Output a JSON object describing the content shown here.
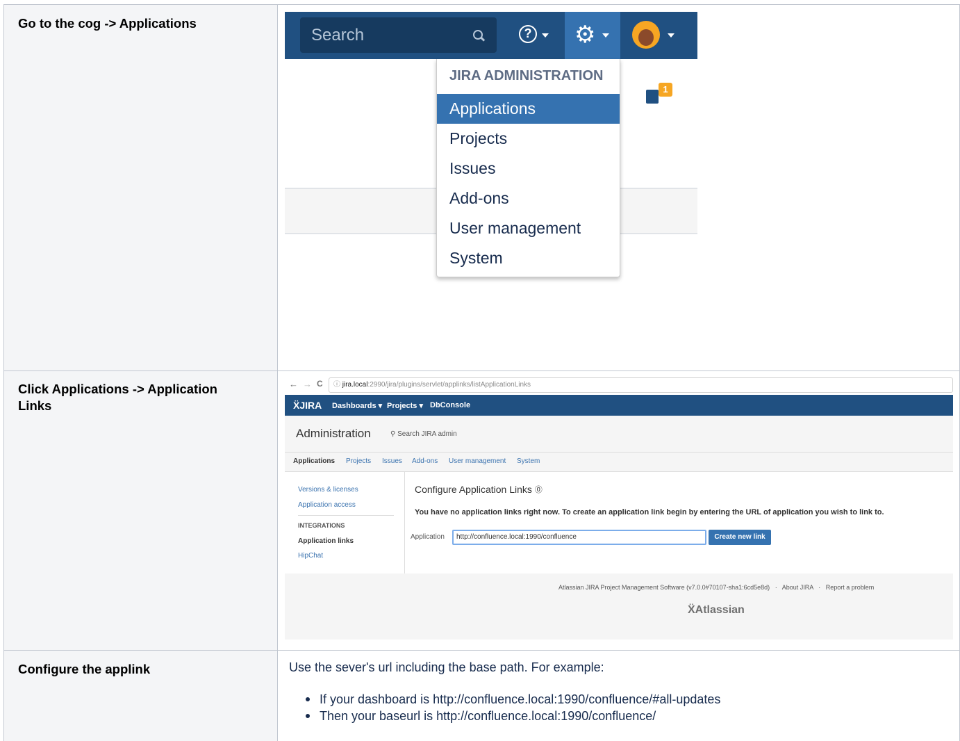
{
  "steps": [
    {
      "label": "Go to the cog -> Applications"
    },
    {
      "label": "Click Applications -> Application Links"
    },
    {
      "label": "Configure the applink"
    }
  ],
  "jira_header": {
    "search_placeholder": "Search",
    "help_glyph": "?",
    "notification_count": "1",
    "icons": [
      "search-icon",
      "help-icon",
      "cog-icon",
      "avatar",
      "feedback-icon"
    ],
    "colors": {
      "header_bg": "#205081",
      "cog_active_bg": "#3572b0",
      "badge": "#f6a623"
    }
  },
  "admin_menu": {
    "heading": "JIRA ADMINISTRATION",
    "items": [
      {
        "label": "Applications",
        "active": true
      },
      {
        "label": "Projects",
        "active": false
      },
      {
        "label": "Issues",
        "active": false
      },
      {
        "label": "Add-ons",
        "active": false
      },
      {
        "label": "User management",
        "active": false
      },
      {
        "label": "System",
        "active": false
      }
    ]
  },
  "browser": {
    "back_glyph": "←",
    "forward_glyph": "→",
    "reload_glyph": "C",
    "url_host": "jira.local",
    "url_rest": ":2990/jira/plugins/servlet/applinks/listApplicationLinks"
  },
  "jira_nav": {
    "logo": "JIRA",
    "items": [
      "Dashboards ▾",
      "Projects ▾",
      "DbConsole"
    ]
  },
  "admin_page": {
    "title": "Administration",
    "search_label": "Search JIRA admin",
    "tabs": [
      "Applications",
      "Projects",
      "Issues",
      "Add-ons",
      "User management",
      "System"
    ],
    "sidebar": {
      "links": [
        "Versions & licenses",
        "Application access"
      ],
      "section_heading": "INTEGRATIONS",
      "current": "Application links",
      "extra": "HipChat"
    },
    "configure_title": "Configure Application Links",
    "help_glyph": "⓪",
    "message": "You have no application links right now. To create an application link begin by entering the URL of application you wish to link to.",
    "application_label": "Application",
    "application_value": "http://confluence.local:1990/confluence",
    "create_button": "Create new link",
    "footer": {
      "product": "Atlassian JIRA Project Management Software (v7.0.0#70107-sha1:6cd5e8d)",
      "about": "About JIRA",
      "report": "Report a problem"
    },
    "brand": "Atlassian"
  },
  "configure_text": {
    "intro": "Use the sever's url including the base path. For example:",
    "bullets": [
      "If your dashboard is http://confluence.local:1990/confluence/#all-updates",
      "Then your baseurl is http://confluence.local:1990/confluence/"
    ]
  }
}
